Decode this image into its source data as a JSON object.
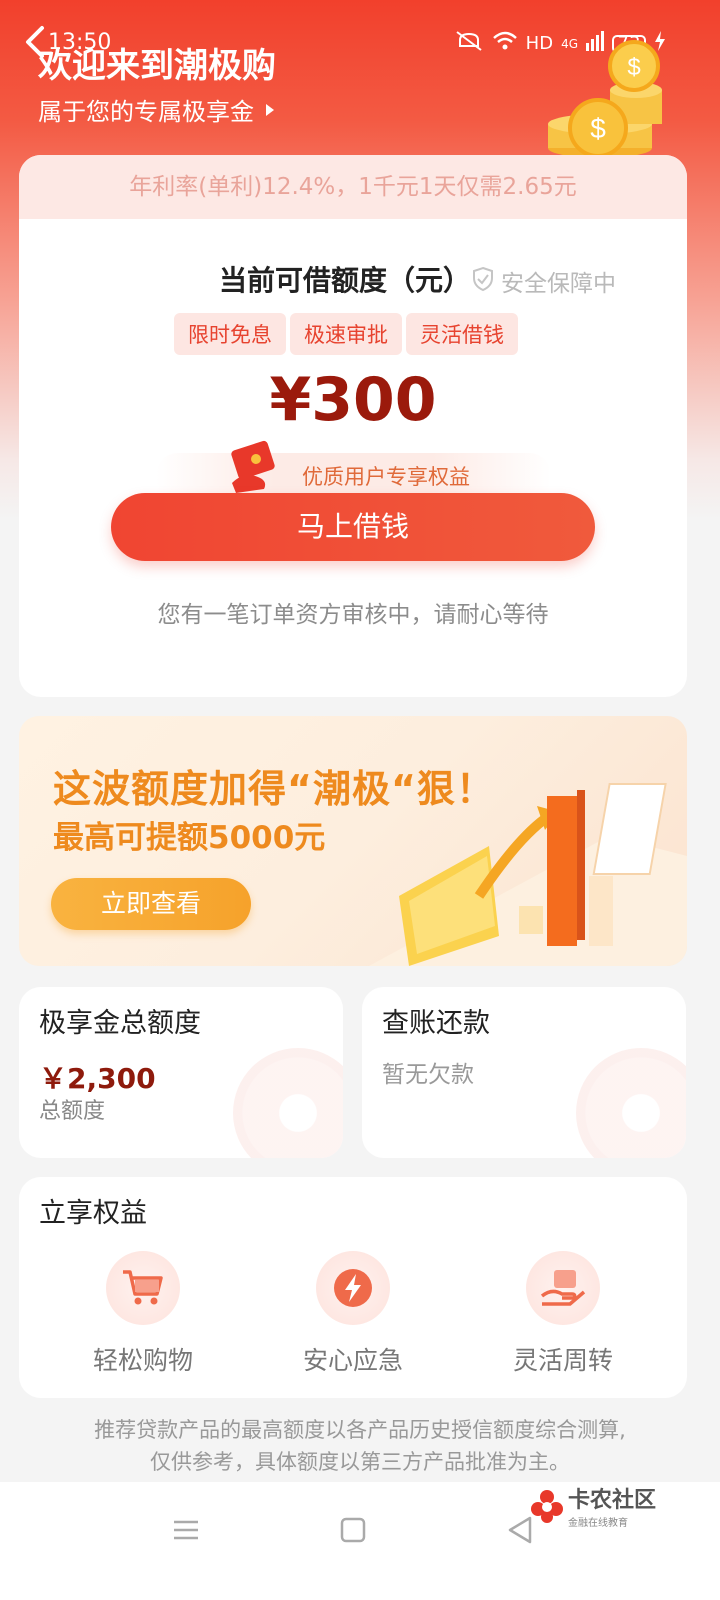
{
  "status_bar": {
    "time": "13:50",
    "network": "HD",
    "signal": "4G",
    "battery": "73"
  },
  "header": {
    "title": "欢迎来到潮极购",
    "subtitle": "属于您的专属极享金"
  },
  "loan_card": {
    "rate_notice": "年利率(单利)12.4%，1千元1天仅需2.65元",
    "quota_label": "当前可借额度（元）",
    "safe_text": "安全保障中",
    "tags": [
      "限时免息",
      "极速审批",
      "灵活借钱"
    ],
    "amount": "¥300",
    "perk_text": "优质用户专享权益",
    "borrow_button": "马上借钱",
    "pending_text": "您有一笔订单资方审核中，请耐心等待"
  },
  "banner": {
    "line1": "这波额度加得“潮极“狠！",
    "line2": "最高可提额5000元",
    "button": "立即查看"
  },
  "total_card": {
    "title": "极享金总额度",
    "amount": "￥2,300",
    "label": "总额度"
  },
  "repay_card": {
    "title": "查账还款",
    "status": "暂无欠款"
  },
  "benefits": {
    "title": "立享权益",
    "items": [
      {
        "label": "轻松购物",
        "icon": "shopping-cart-icon"
      },
      {
        "label": "安心应急",
        "icon": "lightning-icon"
      },
      {
        "label": "灵活周转",
        "icon": "hand-money-icon"
      }
    ]
  },
  "disclaimer": {
    "line1": "推荐贷款产品的最高额度以各产品历史授信额度综合测算,",
    "line2": "仅供参考，具体额度以第三方产品批准为主。"
  },
  "watermark": {
    "title": "卡农社区",
    "subtitle": "金融在线教育"
  },
  "colors": {
    "brand_red": "#f04532",
    "amount_dark_red": "#9b1a0c",
    "banner_orange": "#ee8a1e"
  }
}
